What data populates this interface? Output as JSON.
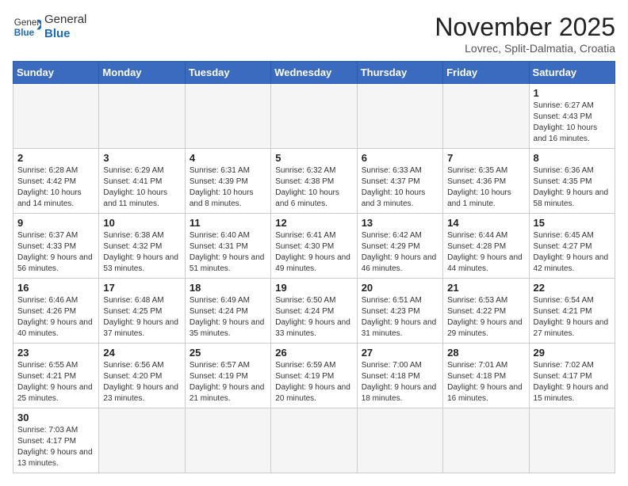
{
  "header": {
    "logo_general": "General",
    "logo_blue": "Blue",
    "month_title": "November 2025",
    "location": "Lovrec, Split-Dalmatia, Croatia"
  },
  "days_of_week": [
    "Sunday",
    "Monday",
    "Tuesday",
    "Wednesday",
    "Thursday",
    "Friday",
    "Saturday"
  ],
  "weeks": [
    [
      {
        "day": "",
        "empty": true
      },
      {
        "day": "",
        "empty": true
      },
      {
        "day": "",
        "empty": true
      },
      {
        "day": "",
        "empty": true
      },
      {
        "day": "",
        "empty": true
      },
      {
        "day": "",
        "empty": true
      },
      {
        "day": "1",
        "sunrise": "6:27 AM",
        "sunset": "4:43 PM",
        "daylight": "10 hours and 16 minutes."
      }
    ],
    [
      {
        "day": "2",
        "sunrise": "6:28 AM",
        "sunset": "4:42 PM",
        "daylight": "10 hours and 14 minutes."
      },
      {
        "day": "3",
        "sunrise": "6:29 AM",
        "sunset": "4:41 PM",
        "daylight": "10 hours and 11 minutes."
      },
      {
        "day": "4",
        "sunrise": "6:31 AM",
        "sunset": "4:39 PM",
        "daylight": "10 hours and 8 minutes."
      },
      {
        "day": "5",
        "sunrise": "6:32 AM",
        "sunset": "4:38 PM",
        "daylight": "10 hours and 6 minutes."
      },
      {
        "day": "6",
        "sunrise": "6:33 AM",
        "sunset": "4:37 PM",
        "daylight": "10 hours and 3 minutes."
      },
      {
        "day": "7",
        "sunrise": "6:35 AM",
        "sunset": "4:36 PM",
        "daylight": "10 hours and 1 minute."
      },
      {
        "day": "8",
        "sunrise": "6:36 AM",
        "sunset": "4:35 PM",
        "daylight": "9 hours and 58 minutes."
      }
    ],
    [
      {
        "day": "9",
        "sunrise": "6:37 AM",
        "sunset": "4:33 PM",
        "daylight": "9 hours and 56 minutes."
      },
      {
        "day": "10",
        "sunrise": "6:38 AM",
        "sunset": "4:32 PM",
        "daylight": "9 hours and 53 minutes."
      },
      {
        "day": "11",
        "sunrise": "6:40 AM",
        "sunset": "4:31 PM",
        "daylight": "9 hours and 51 minutes."
      },
      {
        "day": "12",
        "sunrise": "6:41 AM",
        "sunset": "4:30 PM",
        "daylight": "9 hours and 49 minutes."
      },
      {
        "day": "13",
        "sunrise": "6:42 AM",
        "sunset": "4:29 PM",
        "daylight": "9 hours and 46 minutes."
      },
      {
        "day": "14",
        "sunrise": "6:44 AM",
        "sunset": "4:28 PM",
        "daylight": "9 hours and 44 minutes."
      },
      {
        "day": "15",
        "sunrise": "6:45 AM",
        "sunset": "4:27 PM",
        "daylight": "9 hours and 42 minutes."
      }
    ],
    [
      {
        "day": "16",
        "sunrise": "6:46 AM",
        "sunset": "4:26 PM",
        "daylight": "9 hours and 40 minutes."
      },
      {
        "day": "17",
        "sunrise": "6:48 AM",
        "sunset": "4:25 PM",
        "daylight": "9 hours and 37 minutes."
      },
      {
        "day": "18",
        "sunrise": "6:49 AM",
        "sunset": "4:24 PM",
        "daylight": "9 hours and 35 minutes."
      },
      {
        "day": "19",
        "sunrise": "6:50 AM",
        "sunset": "4:24 PM",
        "daylight": "9 hours and 33 minutes."
      },
      {
        "day": "20",
        "sunrise": "6:51 AM",
        "sunset": "4:23 PM",
        "daylight": "9 hours and 31 minutes."
      },
      {
        "day": "21",
        "sunrise": "6:53 AM",
        "sunset": "4:22 PM",
        "daylight": "9 hours and 29 minutes."
      },
      {
        "day": "22",
        "sunrise": "6:54 AM",
        "sunset": "4:21 PM",
        "daylight": "9 hours and 27 minutes."
      }
    ],
    [
      {
        "day": "23",
        "sunrise": "6:55 AM",
        "sunset": "4:21 PM",
        "daylight": "9 hours and 25 minutes."
      },
      {
        "day": "24",
        "sunrise": "6:56 AM",
        "sunset": "4:20 PM",
        "daylight": "9 hours and 23 minutes."
      },
      {
        "day": "25",
        "sunrise": "6:57 AM",
        "sunset": "4:19 PM",
        "daylight": "9 hours and 21 minutes."
      },
      {
        "day": "26",
        "sunrise": "6:59 AM",
        "sunset": "4:19 PM",
        "daylight": "9 hours and 20 minutes."
      },
      {
        "day": "27",
        "sunrise": "7:00 AM",
        "sunset": "4:18 PM",
        "daylight": "9 hours and 18 minutes."
      },
      {
        "day": "28",
        "sunrise": "7:01 AM",
        "sunset": "4:18 PM",
        "daylight": "9 hours and 16 minutes."
      },
      {
        "day": "29",
        "sunrise": "7:02 AM",
        "sunset": "4:17 PM",
        "daylight": "9 hours and 15 minutes."
      }
    ],
    [
      {
        "day": "30",
        "sunrise": "7:03 AM",
        "sunset": "4:17 PM",
        "daylight": "9 hours and 13 minutes."
      },
      {
        "day": "",
        "empty": true
      },
      {
        "day": "",
        "empty": true
      },
      {
        "day": "",
        "empty": true
      },
      {
        "day": "",
        "empty": true
      },
      {
        "day": "",
        "empty": true
      },
      {
        "day": "",
        "empty": true
      }
    ]
  ]
}
